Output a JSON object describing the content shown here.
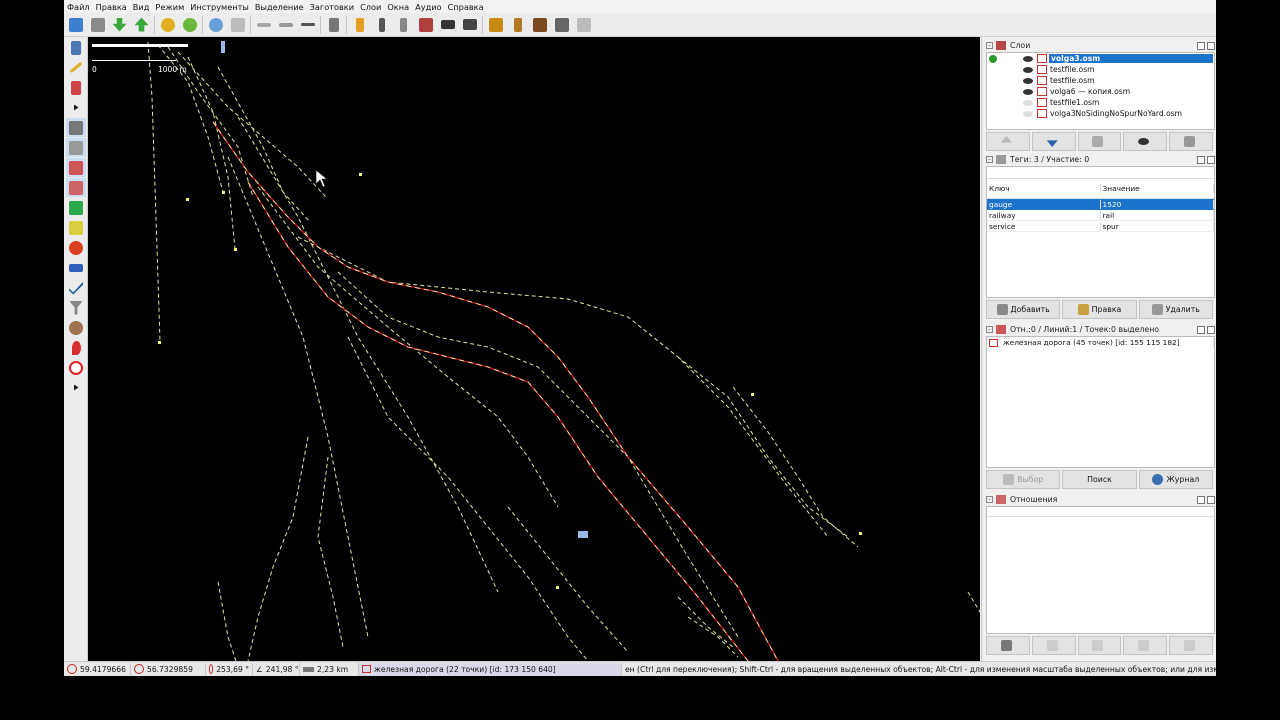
{
  "menu": [
    "Файл",
    "Правка",
    "Вид",
    "Режим",
    "Инструменты",
    "Выделение",
    "Заготовки",
    "Слои",
    "Окна",
    "Аудио",
    "Справка"
  ],
  "toolbar_icons": [
    "open-icon",
    "save-icon",
    "download-icon",
    "upload-icon",
    "undo-icon",
    "redo-icon",
    "zoom-icon",
    "preferences-icon",
    "align-line-icon",
    "align-circle-icon",
    "distribute-icon",
    "split-icon",
    "railway-crossing-icon",
    "rail-signal-icon",
    "brick-wall-icon",
    "car-icon",
    "bus-icon",
    "warning-icon",
    "restaurant-icon",
    "castle-icon",
    "industrial-icon",
    "grid-icon"
  ],
  "map": {
    "scale_start": "0",
    "scale_end": "1000 m"
  },
  "panels": {
    "layers": {
      "title": "Слои",
      "items": [
        {
          "name": "volga3.osm",
          "visible": true,
          "selected": true
        },
        {
          "name": "testfile.osm",
          "visible": true,
          "selected": false
        },
        {
          "name": "testfile.osm",
          "visible": true,
          "selected": false
        },
        {
          "name": "volga6 — копия.osm",
          "visible": true,
          "selected": false
        },
        {
          "name": "testfile1.osm",
          "visible": false,
          "selected": false
        },
        {
          "name": "volga3NoSidingNoSpurNoYard.osm",
          "visible": false,
          "selected": false
        }
      ]
    },
    "tags": {
      "title": "Теги: 3 / Участие: 0",
      "col_key": "Ключ",
      "col_value": "Значение",
      "rows": [
        {
          "key": "gauge",
          "value": "1520"
        },
        {
          "key": "railway",
          "value": "rail"
        },
        {
          "key": "service",
          "value": "spur"
        }
      ],
      "btn_add": "Добавить",
      "btn_edit": "Правка",
      "btn_delete": "Удалить"
    },
    "selection": {
      "title": "Отн.:0 / Линий:1 / Точек:0 выделено",
      "item": "железная дорога (45 точек) [id: 155 115 182]",
      "btn_select": "Выбор",
      "btn_search": "Поиск",
      "btn_history": "Журнал"
    },
    "relations": {
      "title": "Отношения"
    }
  },
  "status": {
    "lat": "59.4179666",
    "lon": "56.7329859",
    "heading": "253,69 °",
    "angle": "241,98 °",
    "distance": "2,23 km",
    "way": "железная дорога (22 точки) [id: 173 150 640]",
    "help": "ен (Ctrl для переключения); Shift-Ctrl - для вращения выделенных объектов; Alt-Ctrl - для изменения масштаба выделенных объектов; или для изменения выделения"
  },
  "colors": {
    "accent": "#1d72cc",
    "track": "#e6e6a0",
    "selected_track": "#cc1a1a",
    "node": "#f2f27a"
  }
}
